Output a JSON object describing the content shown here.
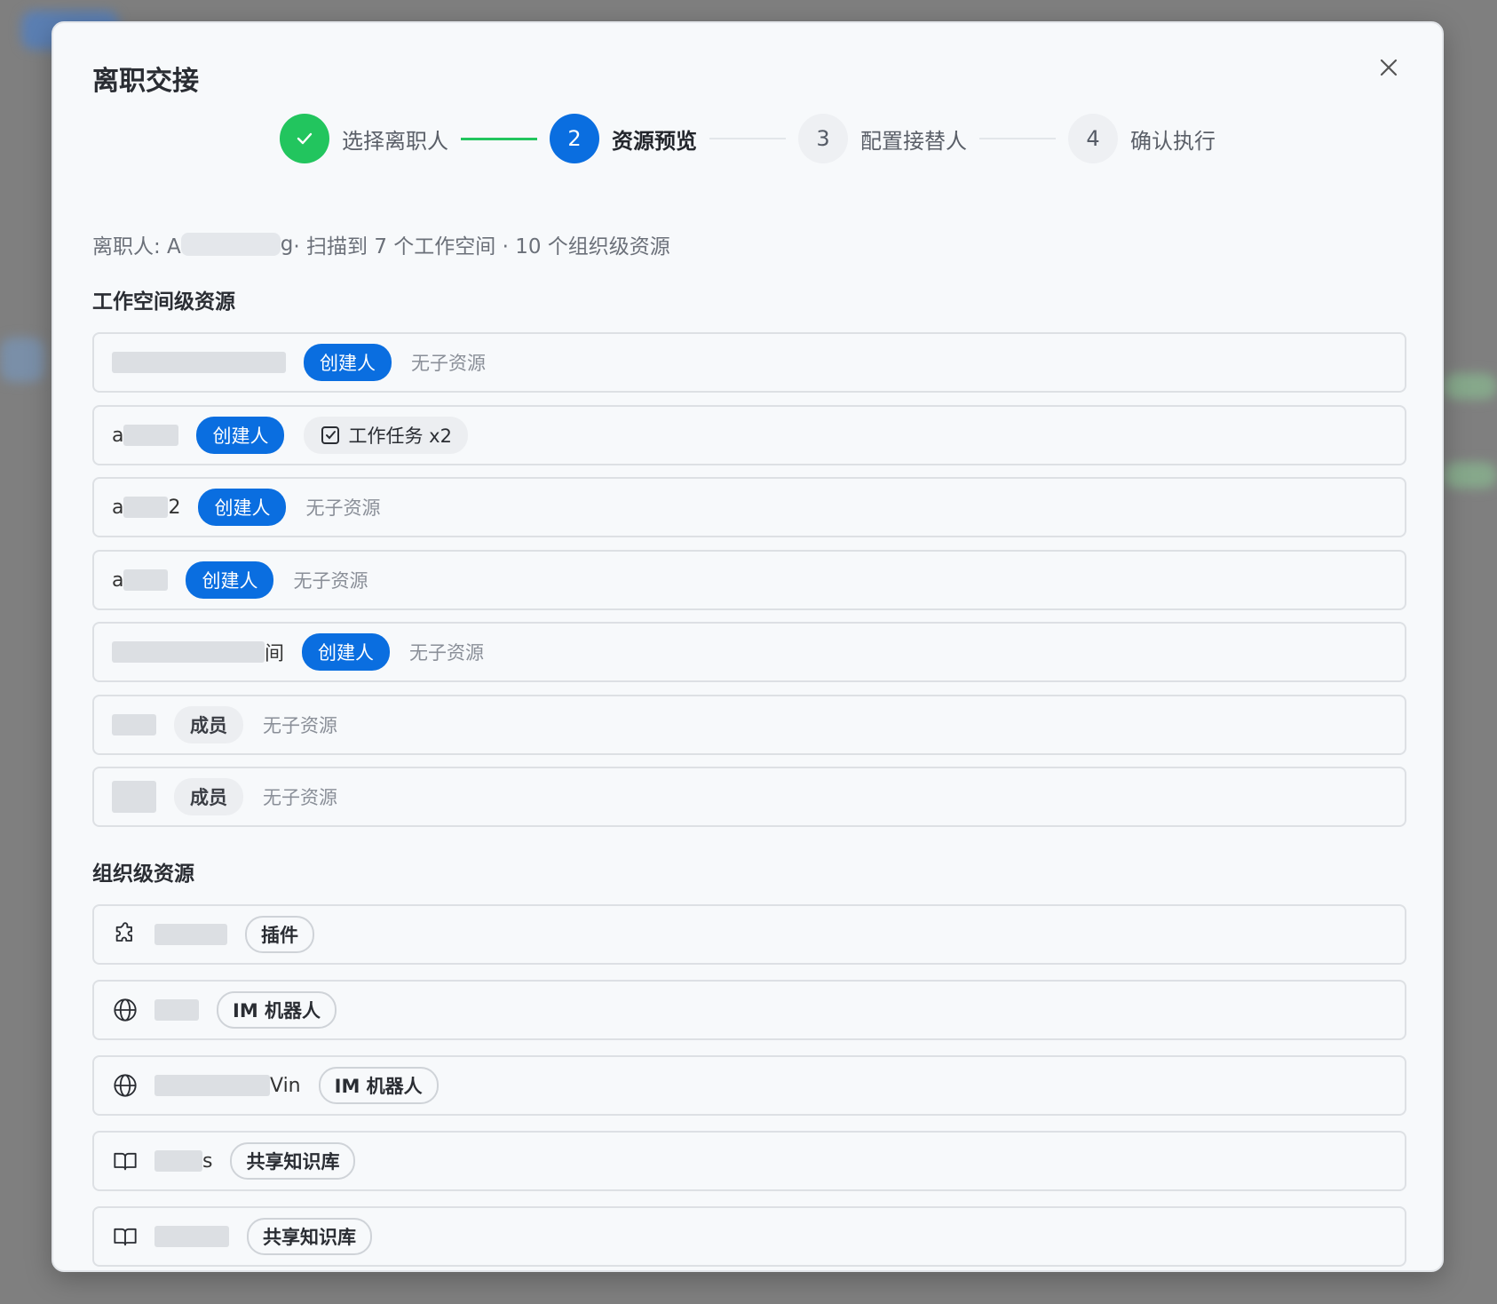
{
  "modal": {
    "title": "离职交接",
    "close_icon": "close-icon"
  },
  "steps": [
    {
      "number": "✓",
      "label": "选择离职人",
      "state": "done"
    },
    {
      "number": "2",
      "label": "资源预览",
      "state": "active"
    },
    {
      "number": "3",
      "label": "配置接替人",
      "state": "pending"
    },
    {
      "number": "4",
      "label": "确认执行",
      "state": "pending"
    }
  ],
  "summary": {
    "prefix": "离职人: A",
    "name_suffix": "g",
    "scan_text": " · 扫描到 7 个工作空间 · 10 个组织级资源"
  },
  "workspace_section": {
    "title": "工作空间级资源",
    "rows": [
      {
        "name_prefix": "",
        "name_suffix": "",
        "role": "创建人",
        "role_type": "owner",
        "resource": "无子资源"
      },
      {
        "name_prefix": "a",
        "name_suffix": "",
        "role": "创建人",
        "role_type": "owner",
        "resource": "工作任务 x2",
        "resource_icon": "checkbox-icon"
      },
      {
        "name_prefix": "a",
        "name_suffix": "2",
        "role": "创建人",
        "role_type": "owner",
        "resource": "无子资源"
      },
      {
        "name_prefix": "a",
        "name_suffix": "",
        "role": "创建人",
        "role_type": "owner",
        "resource": "无子资源"
      },
      {
        "name_prefix": "",
        "name_suffix": "间",
        "role": "创建人",
        "role_type": "owner",
        "resource": "无子资源"
      },
      {
        "name_prefix": "",
        "name_suffix": "",
        "role": "成员",
        "role_type": "member",
        "resource": "无子资源"
      },
      {
        "name_prefix": "",
        "name_suffix": "",
        "role": "成员",
        "role_type": "member",
        "resource": "无子资源"
      }
    ]
  },
  "org_section": {
    "title": "组织级资源",
    "rows": [
      {
        "icon": "puzzle-icon",
        "name_suffix": "",
        "type": "插件"
      },
      {
        "icon": "globe-icon",
        "name_suffix": "",
        "type": "IM 机器人"
      },
      {
        "icon": "globe-icon",
        "name_suffix": "Vin",
        "type": "IM 机器人"
      },
      {
        "icon": "book-icon",
        "name_suffix": "s",
        "type": "共享知识库"
      },
      {
        "icon": "book-icon",
        "name_suffix": "",
        "type": "共享知识库"
      }
    ]
  },
  "colors": {
    "primary": "#0a6ee0",
    "success": "#22c55e",
    "overlay": "#7f7f7f"
  }
}
